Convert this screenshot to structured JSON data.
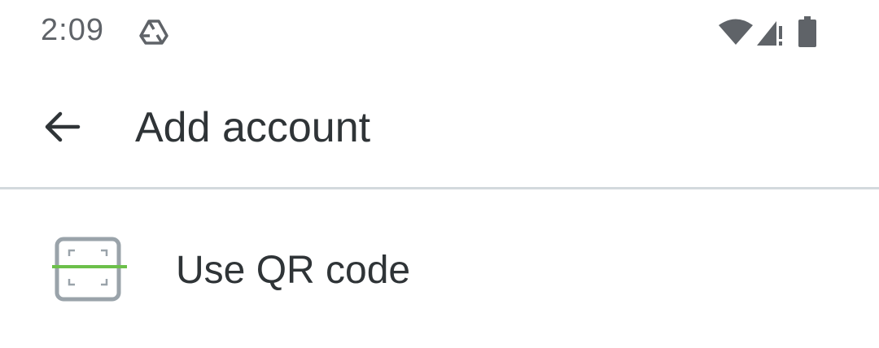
{
  "status_bar": {
    "time": "2:09",
    "icons": [
      "drive-icon",
      "wifi-icon",
      "cell-signal-alert-icon",
      "battery-icon"
    ]
  },
  "toolbar": {
    "back_icon": "arrow-back-icon",
    "title": "Add account"
  },
  "options": [
    {
      "icon": "qr-scan-icon",
      "label": "Use QR code"
    }
  ],
  "colors": {
    "text_primary": "#2f3437",
    "status_gray": "#5f6368",
    "divider": "#d3d9dd",
    "qr_frame": "#9aa3aa",
    "qr_scan_line": "#6cc04a"
  }
}
